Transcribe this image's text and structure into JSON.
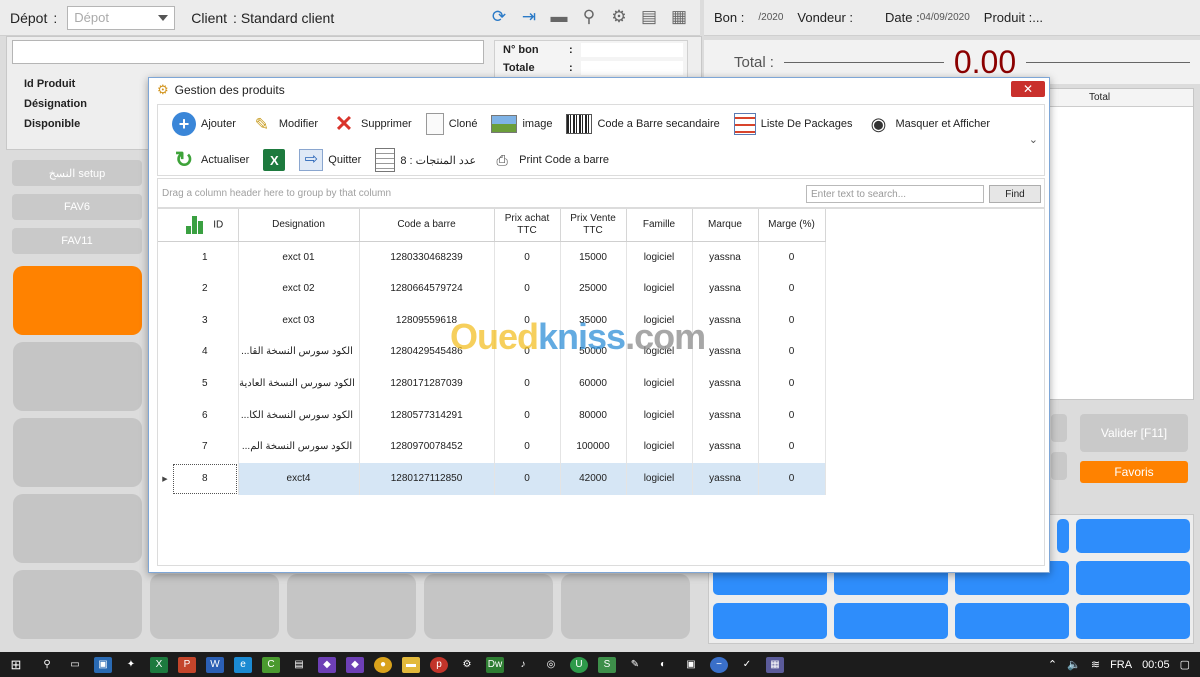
{
  "background": {
    "depot_label": "Dépot",
    "depot_placeholder": "Dépot",
    "client_label": "Client",
    "client_value": ": Standard client",
    "bon_label": "Bon :",
    "bon_value": "/2020",
    "vendeur_label": "Vondeur :",
    "date_label": "Date :",
    "date_value": "04/09/2020",
    "produit_label": "Produit :...",
    "total_label": "Total",
    "total_value": "0.00",
    "right_table_col": "Total",
    "info_labels": [
      "Id Produit",
      "Désignation",
      "Disponible"
    ],
    "nbon_label": "N° bon",
    "totale_label": "Totale",
    "colon": ":",
    "side_buttons": [
      "النسخ setup",
      "FAV6",
      "FAV11"
    ],
    "valider_label": "Valider [F11]",
    "favoris_label": "Favoris",
    "accent_orange": "#ff8200",
    "accent_blue": "#2e8dfb"
  },
  "window": {
    "title": "Gestion des produits",
    "close_label": "✕",
    "toolbar_row1": [
      {
        "label": "Ajouter",
        "icon": "add-icon"
      },
      {
        "label": "Modifier",
        "icon": "edit-icon"
      },
      {
        "label": "Supprimer",
        "icon": "delete-icon"
      },
      {
        "label": "Cloné",
        "icon": "clone-icon"
      },
      {
        "label": "image",
        "icon": "image-icon"
      },
      {
        "label": "Code a Barre secandaire",
        "icon": "barcode-icon"
      },
      {
        "label": "Liste De Packages",
        "icon": "list-icon"
      },
      {
        "label": "Masquer et Afficher",
        "icon": "eye-icon"
      }
    ],
    "toolbar_row2": [
      {
        "label": "Actualiser",
        "icon": "refresh-icon"
      },
      {
        "label": "",
        "icon": "excel-icon"
      },
      {
        "label": "Quitter",
        "icon": "quit-icon"
      },
      {
        "label": "عدد المنتجات : 8",
        "icon": "count-icon"
      },
      {
        "label": "Print Code a barre",
        "icon": "print-icon"
      }
    ],
    "group_hint": "Drag a column header here to group by that column",
    "search_placeholder": "Enter text to search...",
    "find_label": "Find",
    "columns": [
      "ID",
      "Designation",
      "Code a barre",
      "Prix achat TTC",
      "Prix Vente TTC",
      "Famille",
      "Marque",
      "Marge (%)"
    ],
    "rows": [
      {
        "id": "1",
        "designation": "exct 01",
        "code": "1280330468239",
        "prix_achat": "0",
        "prix_vente": "15000",
        "famille": "logiciel",
        "marque": "yassna",
        "marge": "0",
        "rtl": false
      },
      {
        "id": "2",
        "designation": "exct 02",
        "code": "1280664579724",
        "prix_achat": "0",
        "prix_vente": "25000",
        "famille": "logiciel",
        "marque": "yassna",
        "marge": "0",
        "rtl": false
      },
      {
        "id": "3",
        "designation": "exct 03",
        "code": "12809559618",
        "prix_achat": "0",
        "prix_vente": "35000",
        "famille": "logiciel",
        "marque": "yassna",
        "marge": "0",
        "rtl": false
      },
      {
        "id": "4",
        "designation": "الكود سورس النسخة القا...",
        "code": "1280429545486",
        "prix_achat": "0",
        "prix_vente": "50000",
        "famille": "logiciel",
        "marque": "yassna",
        "marge": "0",
        "rtl": true
      },
      {
        "id": "5",
        "designation": "الكود سورس النسخة العادية",
        "code": "1280171287039",
        "prix_achat": "0",
        "prix_vente": "60000",
        "famille": "logiciel",
        "marque": "yassna",
        "marge": "0",
        "rtl": true
      },
      {
        "id": "6",
        "designation": "الكود سورس النسخة الكا...",
        "code": "1280577314291",
        "prix_achat": "0",
        "prix_vente": "80000",
        "famille": "logiciel",
        "marque": "yassna",
        "marge": "0",
        "rtl": true
      },
      {
        "id": "7",
        "designation": "الكود سورس النسخة الم...",
        "code": "1280970078452",
        "prix_achat": "0",
        "prix_vente": "100000",
        "famille": "logiciel",
        "marque": "yassna",
        "marge": "0",
        "rtl": true
      },
      {
        "id": "8",
        "designation": "exct4",
        "code": "1280127112850",
        "prix_achat": "0",
        "prix_vente": "42000",
        "famille": "logiciel",
        "marque": "yassna",
        "marge": "0",
        "rtl": false,
        "selected": true
      }
    ]
  },
  "watermark": {
    "part1": "Oued",
    "part2": "kniss",
    "part3": ".com"
  },
  "taskbar": {
    "language": "FRA",
    "time": "00:05"
  }
}
